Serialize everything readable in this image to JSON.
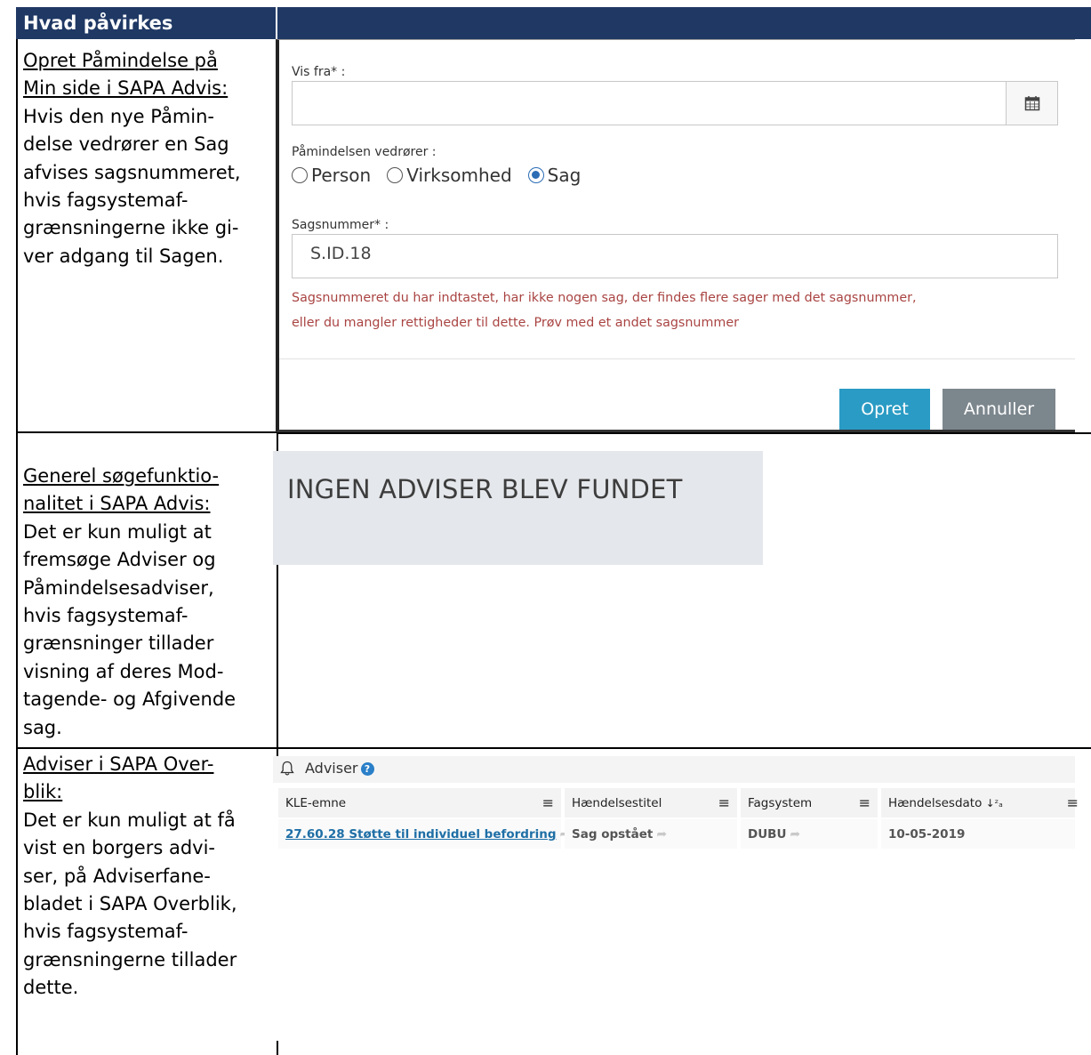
{
  "header": {
    "title": "Hvad påvirkes"
  },
  "rows": [
    {
      "link_lines": [
        "Opret Påmindelse på",
        "Min side i SAPA Advis:"
      ],
      "body_lines": [
        "Hvis den nye Påmin-",
        "delse vedrører en Sag",
        "afvises sagsnummeret,",
        "hvis fagsystemaf-",
        "grænsningerne ikke gi-",
        "ver adgang til Sagen."
      ]
    },
    {
      "link_lines": [
        "Generel søgefunktio-",
        "nalitet i SAPA Advis:"
      ],
      "body_lines": [
        "Det er kun muligt at",
        "fremsøge Adviser og",
        "Påmindelsesadviser,",
        "hvis fagsystemaf-",
        "grænsninger tillader",
        "visning af deres Mod-",
        "tagende- og Afgivende",
        "sag."
      ]
    },
    {
      "link_lines": [
        "Adviser i SAPA Over-",
        "blik:"
      ],
      "body_lines": [
        "Det er kun muligt at få",
        "vist en borgers advi-",
        "ser, på Adviserfane-",
        "bladet i SAPA Overblik,",
        "hvis fagsystemaf-",
        "grænsningerne tillader",
        "dette."
      ]
    }
  ],
  "dialog": {
    "vis_fra_label": "Vis fra* :",
    "vis_fra_value": "",
    "vedrorer_label": "Påmindelsen vedrører :",
    "radio_options": [
      "Person",
      "Virksomhed",
      "Sag"
    ],
    "radio_selected": "Sag",
    "sagsnummer_label": "Sagsnummer* :",
    "sagsnummer_value": "S.ID.18",
    "error_line1": "Sagsnummeret du har indtastet, har ikke nogen sag, der findes flere sager med det sagsnummer,",
    "error_line2": "eller du mangler rettigheder til dette. Prøv med et andet sagsnummer",
    "opret_label": "Opret",
    "annuller_label": "Annuller",
    "calendar_icon": "calendar-icon"
  },
  "search_result": {
    "message": "INGEN ADVISER BLEV FUNDET"
  },
  "adviser": {
    "title": "Adviser",
    "help_icon": "?",
    "columns": [
      "KLE-emne",
      "Hændelsestitel",
      "Fagsystem",
      "Hændelsesdato"
    ],
    "rows": [
      {
        "kle": "27.60.28 Støtte til individuel befordring",
        "titel": "Sag opstået",
        "fagsystem": "DUBU",
        "dato": "10-05-2019"
      }
    ]
  },
  "colors": {
    "header_bg": "#1f3864",
    "primary_button": "#2a9bc4",
    "secondary_button": "#7c868d",
    "error_text": "#a94442"
  }
}
